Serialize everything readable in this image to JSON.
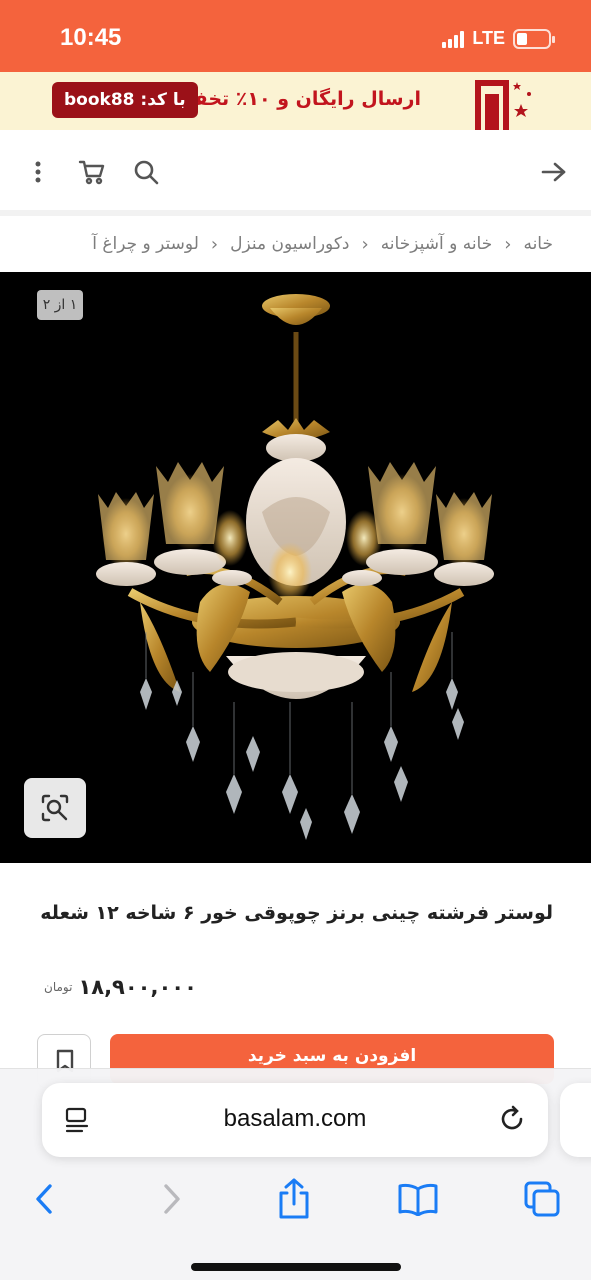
{
  "status_bar": {
    "time": "10:45",
    "network": "LTE",
    "icons": [
      "signal-icon",
      "battery-icon"
    ]
  },
  "promo": {
    "text": "ارسال رایگان و ۱۰٪ تخفیف",
    "code_label": "با کد: book88",
    "colors": {
      "background": "#fbf3d3",
      "text": "#c2151e",
      "badge": "#9b1118"
    }
  },
  "nav": {
    "icons": [
      "more-vertical-icon",
      "cart-icon",
      "search-icon",
      "back-arrow-icon"
    ]
  },
  "breadcrumb": {
    "items": [
      "خانه",
      "خانه و آشپزخانه",
      "دکوراسیون منزل",
      "لوستر و چراغ آ"
    ]
  },
  "gallery": {
    "counter": "۱ از ۲",
    "zoom_icon": "visual-search-icon"
  },
  "product": {
    "title": "لوستر فرشته چینی برنز چوپوقی خور ۶ شاخه ۱۲ شعله",
    "price": "۱۸,۹۰۰,۰۰۰",
    "currency": "تومان",
    "add_to_cart": "افزودن به سبد خرید",
    "bookmark_icon": "bookmark-icon"
  },
  "browser": {
    "url": "basalam.com",
    "icons": [
      "reader-icon",
      "reload-icon",
      "back-icon",
      "forward-icon",
      "share-icon",
      "bookmarks-icon",
      "tabs-icon"
    ]
  },
  "theme": {
    "accent": "#f4633d",
    "ios_blue": "#1a7cf5"
  }
}
